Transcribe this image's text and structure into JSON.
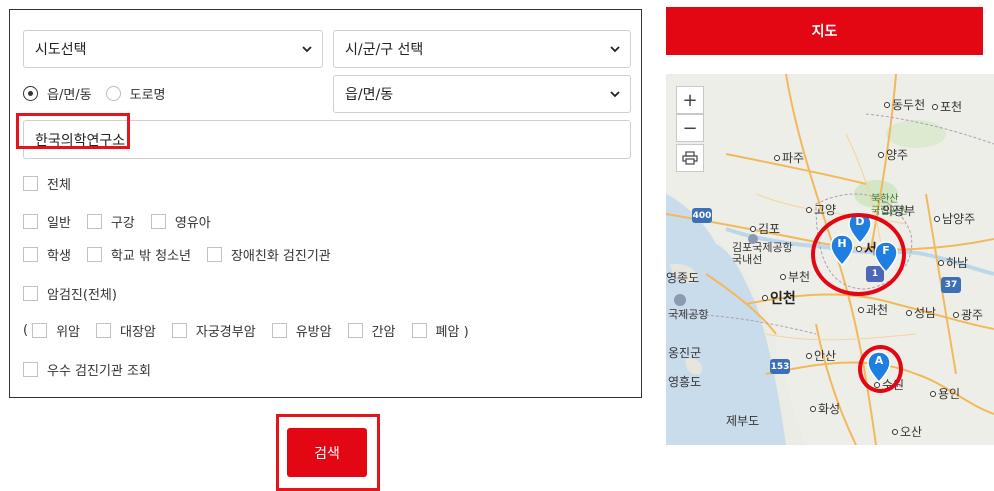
{
  "form": {
    "sido_select": "시도선택",
    "sigungu_select": "시/군/구 선택",
    "emd_select": "읍/면/동",
    "radio_emd": "읍/면/동",
    "radio_road": "도로명",
    "search_value": "한국의학연구소",
    "all_label": "전체",
    "general_label": "일반",
    "oral_label": "구강",
    "infant_label": "영유아",
    "student_label": "학생",
    "outofschool_label": "학교 밖 청소년",
    "disability_label": "장애친화 검진기관",
    "cancer_all_label": "암검진(전체)",
    "paren_open": "(",
    "stomach_label": "위암",
    "colon_label": "대장암",
    "cervical_label": "자궁경부암",
    "breast_label": "유방암",
    "liver_label": "간암",
    "lung_label": "폐암 )",
    "excellent_label": "우수 검진기관 조회",
    "search_button": "검색"
  },
  "map": {
    "header": "지도",
    "zoom_in": "+",
    "zoom_out": "−",
    "places": {
      "dongducheon": "동두천",
      "pocheon": "포천",
      "paju": "파주",
      "yangju": "양주",
      "bukhansan": "북한산",
      "bukhansan2": "국립공원",
      "goyang": "고양",
      "uijeongbu": "의정부",
      "namyangju": "남양주",
      "gimpo": "김포",
      "gimpo_airport": "김포국제공항",
      "domestic": "국내선",
      "seoul": "서",
      "hanam": "하남",
      "yeongjongdo": "영종도",
      "bucheon": "부천",
      "incheon": "인천",
      "airport": "국제공항",
      "gwacheon": "과천",
      "seongnam": "성남",
      "gwangju": "광주",
      "ongjin": "옹진군",
      "ansan": "안산",
      "yeongheungdo": "영흥도",
      "suwon": "수원",
      "yongin": "용인",
      "hwaseong": "화성",
      "jebudo": "제부도",
      "osan": "오산"
    },
    "markers": [
      "A",
      "D",
      "F",
      "H"
    ],
    "shields": {
      "route400": "400",
      "route1": "1",
      "route37": "37",
      "route153": "153"
    }
  },
  "colors": {
    "accent_red": "#e30613",
    "marker_blue": "#1f7fe0"
  }
}
